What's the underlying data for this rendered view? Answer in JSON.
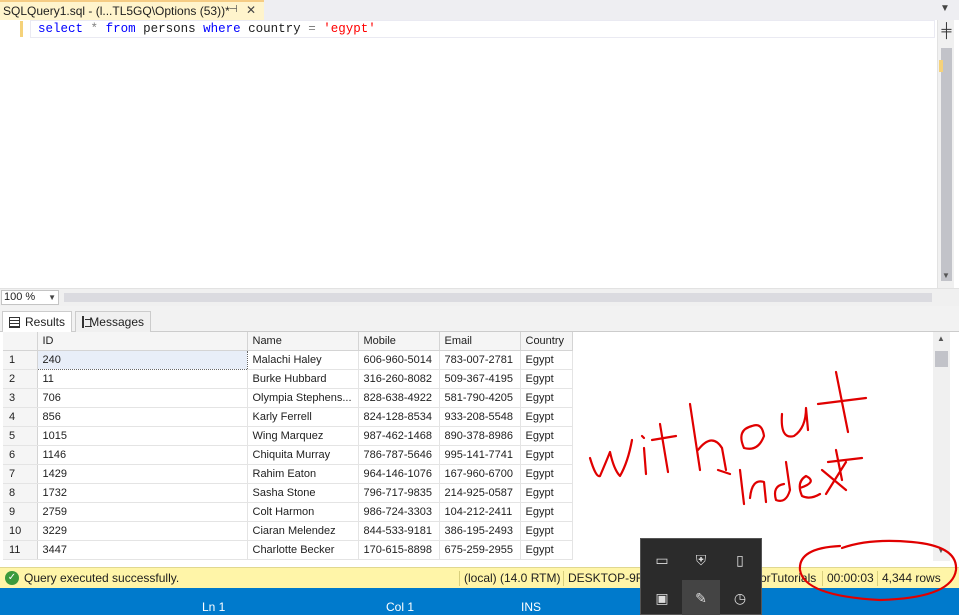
{
  "tab": {
    "title": "SQLQuery1.sql - (l...TL5GQ\\Options (53))*",
    "pin_glyph": "⊣",
    "close_glyph": "✕"
  },
  "editor": {
    "code": {
      "select": "select",
      "star": "*",
      "from": "from",
      "table": "persons",
      "where": "where",
      "column": "country",
      "op": "=",
      "literal": "'egypt'"
    }
  },
  "zoom": {
    "value": "100 %"
  },
  "results_tabs": {
    "results": "Results",
    "messages": "Messages"
  },
  "grid": {
    "columns": [
      "ID",
      "Name",
      "Mobile",
      "Email",
      "Country"
    ],
    "rows": [
      {
        "n": "1",
        "id": "240",
        "name": "Malachi Haley",
        "mobile": "606-960-5014",
        "email": "783-007-2781",
        "country": "Egypt"
      },
      {
        "n": "2",
        "id": "11",
        "name": "Burke Hubbard",
        "mobile": "316-260-8082",
        "email": "509-367-4195",
        "country": "Egypt"
      },
      {
        "n": "3",
        "id": "706",
        "name": "Olympia Stephens...",
        "mobile": "828-638-4922",
        "email": "581-790-4205",
        "country": "Egypt"
      },
      {
        "n": "4",
        "id": "856",
        "name": "Karly Ferrell",
        "mobile": "824-128-8534",
        "email": "933-208-5548",
        "country": "Egypt"
      },
      {
        "n": "5",
        "id": "1015",
        "name": "Wing Marquez",
        "mobile": "987-462-1468",
        "email": "890-378-8986",
        "country": "Egypt"
      },
      {
        "n": "6",
        "id": "1146",
        "name": "Chiquita Murray",
        "mobile": "786-787-5646",
        "email": "995-141-7741",
        "country": "Egypt"
      },
      {
        "n": "7",
        "id": "1429",
        "name": "Rahim Eaton",
        "mobile": "964-146-1076",
        "email": "167-960-6700",
        "country": "Egypt"
      },
      {
        "n": "8",
        "id": "1732",
        "name": "Sasha Stone",
        "mobile": "796-717-9835",
        "email": "214-925-0587",
        "country": "Egypt"
      },
      {
        "n": "9",
        "id": "2759",
        "name": "Colt Harmon",
        "mobile": "986-724-3303",
        "email": "104-212-2411",
        "country": "Egypt"
      },
      {
        "n": "10",
        "id": "3229",
        "name": "Ciaran Melendez",
        "mobile": "844-533-9181",
        "email": "386-195-2493",
        "country": "Egypt"
      },
      {
        "n": "11",
        "id": "3447",
        "name": "Charlotte Becker",
        "mobile": "170-615-8898",
        "email": "675-259-2955",
        "country": "Egypt"
      }
    ]
  },
  "query_status": {
    "message": "Query executed successfully.",
    "server": "(local) (14.0 RTM)",
    "machine": "DESKTOP-9RT",
    "database": "orTutorials",
    "elapsed": "00:00:03",
    "rows": "4,344 rows"
  },
  "bottom_status": {
    "ln": "Ln 1",
    "col": "Col 1",
    "mode": "INS"
  },
  "annotation": {
    "line1": "without",
    "line2": "index"
  },
  "colors": {
    "accent": "#007acc",
    "status_yellow": "#fff5a8",
    "tab_yellow": "#fff4cc",
    "ink": "#e00000"
  }
}
